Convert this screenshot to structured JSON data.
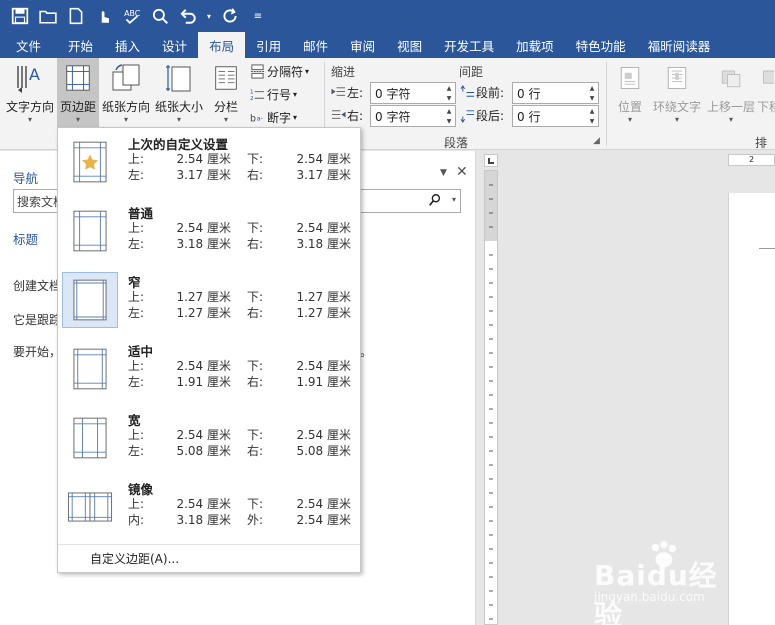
{
  "tabs": [
    "文件",
    "开始",
    "插入",
    "设计",
    "布局",
    "引用",
    "邮件",
    "审阅",
    "视图",
    "开发工具",
    "加载项",
    "特色功能",
    "福昕阅读器"
  ],
  "active_tab_index": 4,
  "ribbon": {
    "text_direction": "文字方向",
    "margins": "页边距",
    "orientation": "纸张方向",
    "size": "纸张大小",
    "columns": "分栏",
    "breaks": "分隔符",
    "line_numbers": "行号",
    "hyphenation": "断字",
    "indent_label": "缩进",
    "spacing_label": "间距",
    "indent_left_label": "左:",
    "indent_right_label": "右:",
    "indent_left_value": "0 字符",
    "indent_right_value": "0 字符",
    "space_before_label": "段前:",
    "space_after_label": "段后:",
    "space_before_value": "0 行",
    "space_after_value": "0 行",
    "paragraph_group": "段落",
    "position": "位置",
    "wrap_text": "环绕文字",
    "bring_forward": "上移一层",
    "send_backward": "下移",
    "arrange_group": "排列"
  },
  "nav_pane": {
    "title": "导航",
    "search_placeholder": "搜索文档",
    "headings_tab": "标题",
    "text_1": "创建文档",
    "text_2": "它是跟踪",
    "text_3": "要开始，",
    "text_tail": "。"
  },
  "ruler": {
    "h_label": "2"
  },
  "margins_menu": {
    "presets": [
      {
        "name": "上次的自定义设置",
        "k1": "上:",
        "v1": "2.54 厘米",
        "k2": "下:",
        "v2": "2.54 厘米",
        "k3": "左:",
        "v3": "3.17 厘米",
        "k4": "右:",
        "v4": "3.17 厘米"
      },
      {
        "name": "普通",
        "k1": "上:",
        "v1": "2.54 厘米",
        "k2": "下:",
        "v2": "2.54 厘米",
        "k3": "左:",
        "v3": "3.18 厘米",
        "k4": "右:",
        "v4": "3.18 厘米"
      },
      {
        "name": "窄",
        "k1": "上:",
        "v1": "1.27 厘米",
        "k2": "下:",
        "v2": "1.27 厘米",
        "k3": "左:",
        "v3": "1.27 厘米",
        "k4": "右:",
        "v4": "1.27 厘米"
      },
      {
        "name": "适中",
        "k1": "上:",
        "v1": "2.54 厘米",
        "k2": "下:",
        "v2": "2.54 厘米",
        "k3": "左:",
        "v3": "1.91 厘米",
        "k4": "右:",
        "v4": "1.91 厘米"
      },
      {
        "name": "宽",
        "k1": "上:",
        "v1": "2.54 厘米",
        "k2": "下:",
        "v2": "2.54 厘米",
        "k3": "左:",
        "v3": "5.08 厘米",
        "k4": "右:",
        "v4": "5.08 厘米"
      },
      {
        "name": "镜像",
        "k1": "上:",
        "v1": "2.54 厘米",
        "k2": "下:",
        "v2": "2.54 厘米",
        "k3": "内:",
        "v3": "3.18 厘米",
        "k4": "外:",
        "v4": "2.54 厘米"
      }
    ],
    "custom_margins": "自定义边距(A)..."
  },
  "watermark": {
    "logo": "Baidu经验",
    "sub": "jingyan.baidu.com"
  },
  "colors": {
    "title_bar": "#2b579a",
    "ribbon_bg": "#f3f3f3",
    "highlight": "#dbe7f6",
    "star": "#e8b34a"
  }
}
